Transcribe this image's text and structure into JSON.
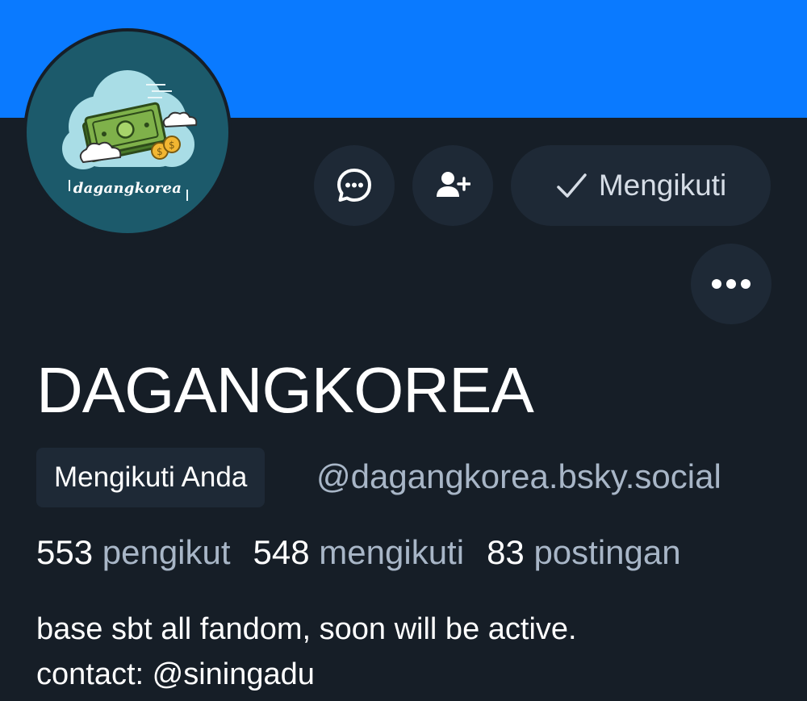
{
  "profile": {
    "avatar_text": "dagangkorea",
    "display_name": "DAGANGKOREA",
    "follows_you_label": "Mengikuti Anda",
    "handle": "@dagangkorea.bsky.social",
    "bio_line1": "base sbt all fandom, soon will be active.",
    "bio_line2": "contact: @siningadu"
  },
  "actions": {
    "chat_icon": "chat-bubble-icon",
    "add_friend_icon": "person-add-icon",
    "follow_label": "Mengikuti",
    "follow_icon": "checkmark-icon",
    "more_icon": "ellipsis-icon"
  },
  "stats": {
    "followers_count": "553",
    "followers_label": "pengikut",
    "following_count": "548",
    "following_label": "mengikuti",
    "posts_count": "83",
    "posts_label": "postingan"
  },
  "colors": {
    "banner": "#0a7aff",
    "background": "#161e27",
    "button_bg": "#1e2936",
    "muted_text": "#a8b6c7",
    "avatar_bg": "#1c5a6b"
  }
}
